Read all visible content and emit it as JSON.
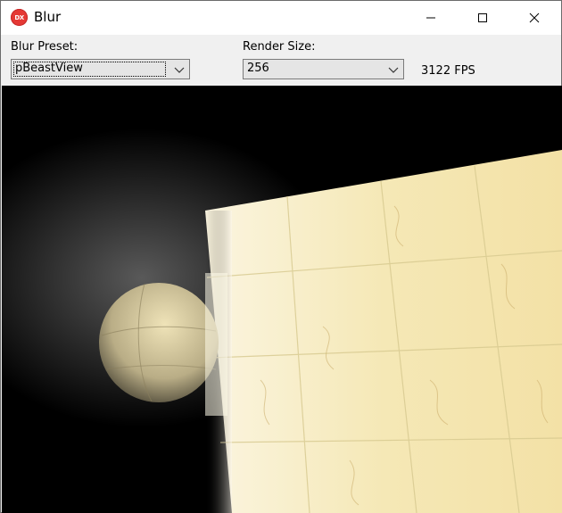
{
  "window": {
    "title": "Blur",
    "app_icon_text": "DX",
    "app_icon_name": "directx-icon",
    "icon_color": "#e53935"
  },
  "toolbar": {
    "blur_preset_label": "Blur Preset:",
    "blur_preset_value": "pBeastView",
    "render_size_label": "Render Size:",
    "render_size_value": "256",
    "fps_text": "3122 FPS"
  },
  "caption_buttons": [
    "minimize",
    "maximize",
    "close"
  ],
  "viewport": {
    "scene": "3D render: textured marble sphere beside tiled marble floor with bright blur glow",
    "colors": {
      "background": "#000000",
      "marble_light": "#fdf6d8",
      "marble_tile": "#f3e2a8"
    }
  }
}
